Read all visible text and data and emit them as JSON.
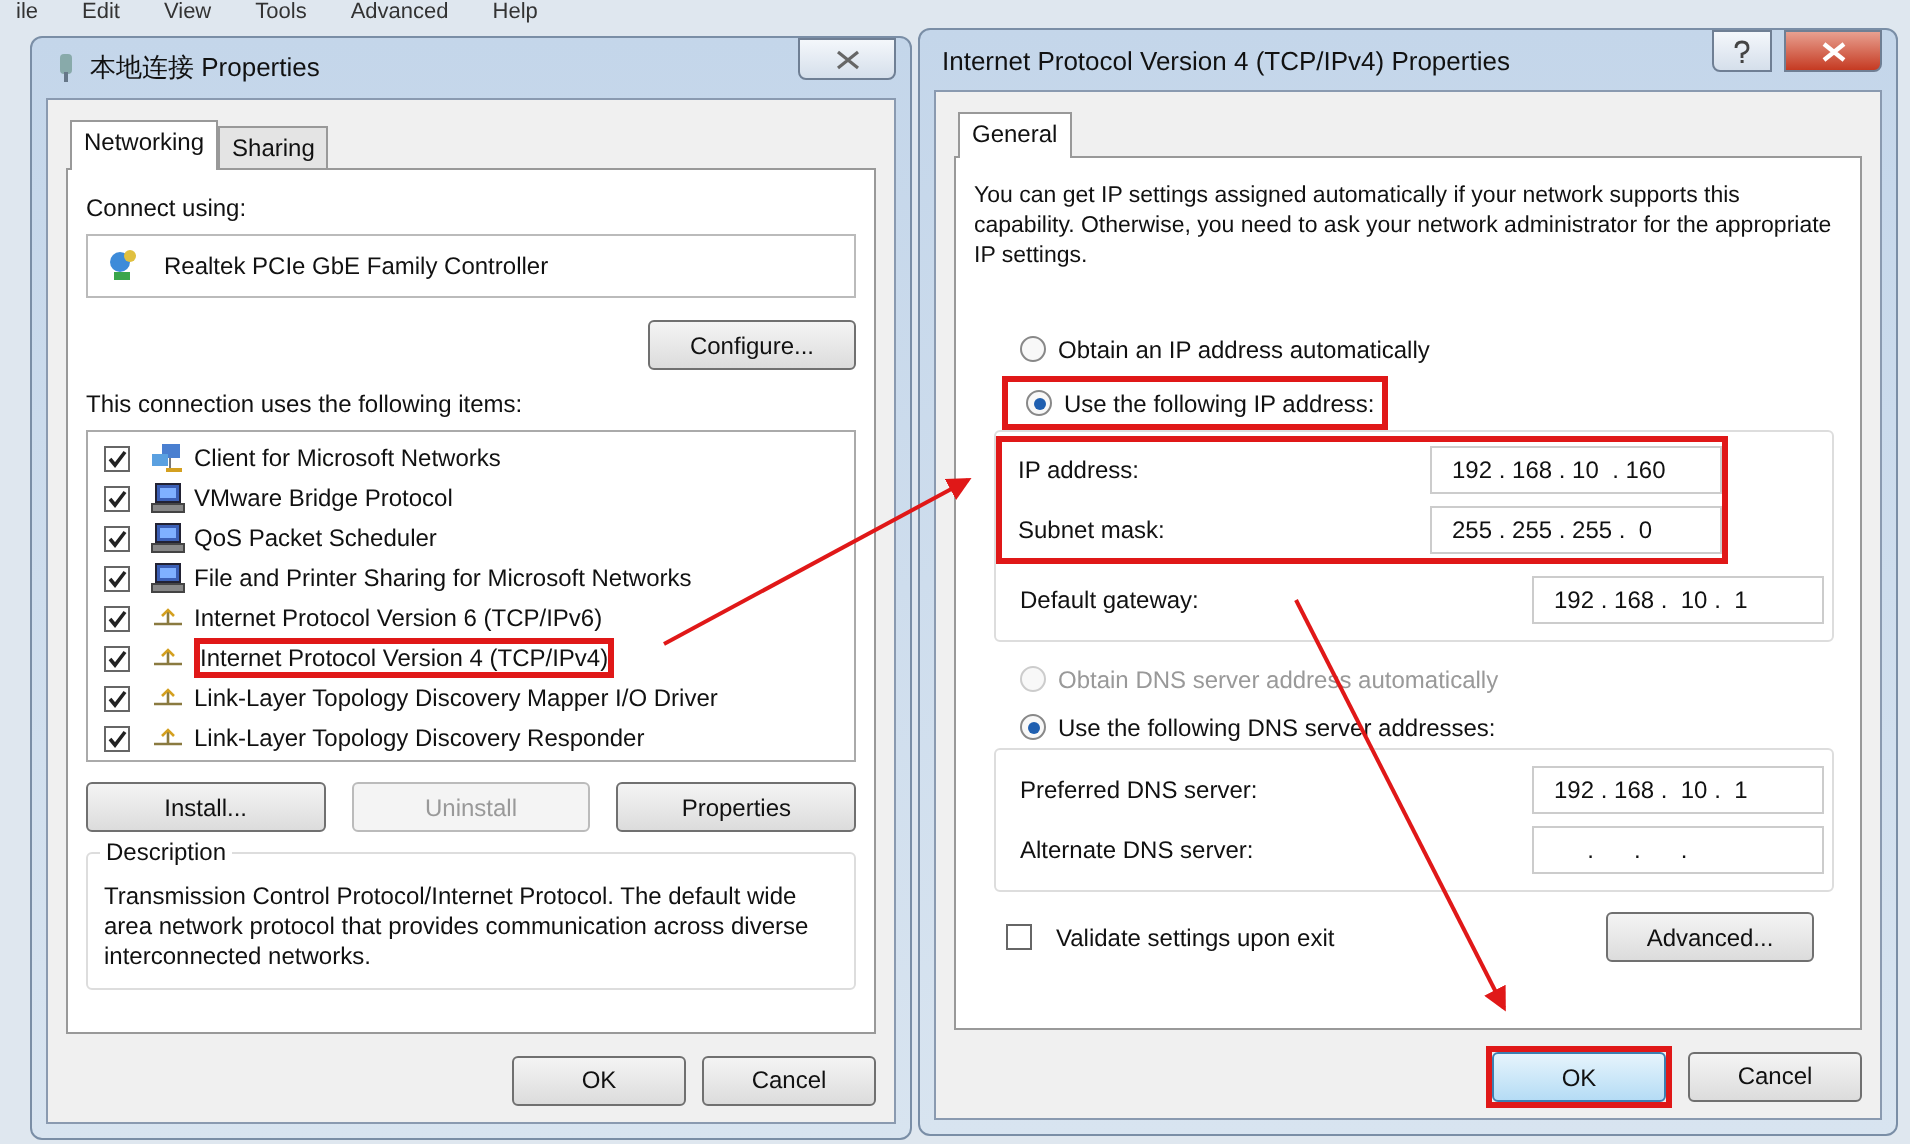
{
  "menu_bar": [
    "ile",
    "Edit",
    "View",
    "Tools",
    "Advanced",
    "Help"
  ],
  "connection_dialog": {
    "title": "本地连接 Properties",
    "tabs": [
      {
        "label": "Networking",
        "selected": true
      },
      {
        "label": "Sharing",
        "selected": false
      }
    ],
    "connect_using_label": "Connect using:",
    "adapter": "Realtek PCIe GbE Family Controller",
    "configure_button": "Configure...",
    "items_label": "This connection uses the following items:",
    "items": [
      {
        "kind": "client",
        "label": "Client for Microsoft Networks",
        "checked": true,
        "highlighted": false
      },
      {
        "kind": "service",
        "label": "VMware Bridge Protocol",
        "checked": true,
        "highlighted": false
      },
      {
        "kind": "service",
        "label": "QoS Packet Scheduler",
        "checked": true,
        "highlighted": false
      },
      {
        "kind": "service",
        "label": "File and Printer Sharing for Microsoft Networks",
        "checked": true,
        "highlighted": false
      },
      {
        "kind": "protocol",
        "label": "Internet Protocol Version 6 (TCP/IPv6)",
        "checked": true,
        "highlighted": false
      },
      {
        "kind": "protocol",
        "label": "Internet Protocol Version 4 (TCP/IPv4)",
        "checked": true,
        "highlighted": true
      },
      {
        "kind": "protocol",
        "label": "Link-Layer Topology Discovery Mapper I/O Driver",
        "checked": true,
        "highlighted": false
      },
      {
        "kind": "protocol",
        "label": "Link-Layer Topology Discovery Responder",
        "checked": true,
        "highlighted": false
      }
    ],
    "item_buttons": [
      {
        "label": "Install...",
        "disabled": false
      },
      {
        "label": "Uninstall",
        "disabled": true
      },
      {
        "label": "Properties",
        "disabled": false
      }
    ],
    "description": {
      "title": "Description",
      "text": "Transmission Control Protocol/Internet Protocol. The default wide area network protocol that provides communication across diverse interconnected networks."
    },
    "buttons": [
      {
        "label": "OK",
        "focused": false,
        "highlighted": false
      },
      {
        "label": "Cancel",
        "focused": false,
        "highlighted": false
      }
    ]
  },
  "ipv4_dialog": {
    "title": "Internet Protocol Version 4 (TCP/IPv4) Properties",
    "tabs": [
      {
        "label": "General",
        "selected": true
      }
    ],
    "intro": "You can get IP settings assigned automatically if your network supports this capability. Otherwise, you need to ask your network administrator for the appropriate IP settings.",
    "ip_options": [
      {
        "label": "Obtain an IP address automatically",
        "selected": false,
        "disabled": false,
        "highlighted": false
      },
      {
        "label": "Use the following IP address:",
        "selected": true,
        "disabled": false,
        "highlighted": true
      }
    ],
    "ip_fields": [
      {
        "label": "IP address:",
        "value": "192 . 168 . 10  . 160",
        "highlighted": true
      },
      {
        "label": "Subnet mask:",
        "value": "255 . 255 . 255 .  0",
        "highlighted": true
      },
      {
        "label": "Default gateway:",
        "value": "192 . 168 .  10 .  1",
        "highlighted": false
      }
    ],
    "dns_options": [
      {
        "label": "Obtain DNS server address automatically",
        "selected": false,
        "disabled": true,
        "highlighted": false
      },
      {
        "label": "Use the following DNS server addresses:",
        "selected": true,
        "disabled": false,
        "highlighted": false
      }
    ],
    "dns_fields": [
      {
        "label": "Preferred DNS server:",
        "value": "192 . 168 .  10 .  1",
        "highlighted": false
      },
      {
        "label": "Alternate DNS server:",
        "value": "     .      .      .",
        "highlighted": false
      }
    ],
    "validate": {
      "label": "Validate settings upon exit",
      "checked": false
    },
    "advanced_button": "Advanced...",
    "buttons": [
      {
        "label": "OK",
        "focused": true,
        "highlighted": true
      },
      {
        "label": "Cancel",
        "focused": false,
        "highlighted": false
      }
    ]
  }
}
